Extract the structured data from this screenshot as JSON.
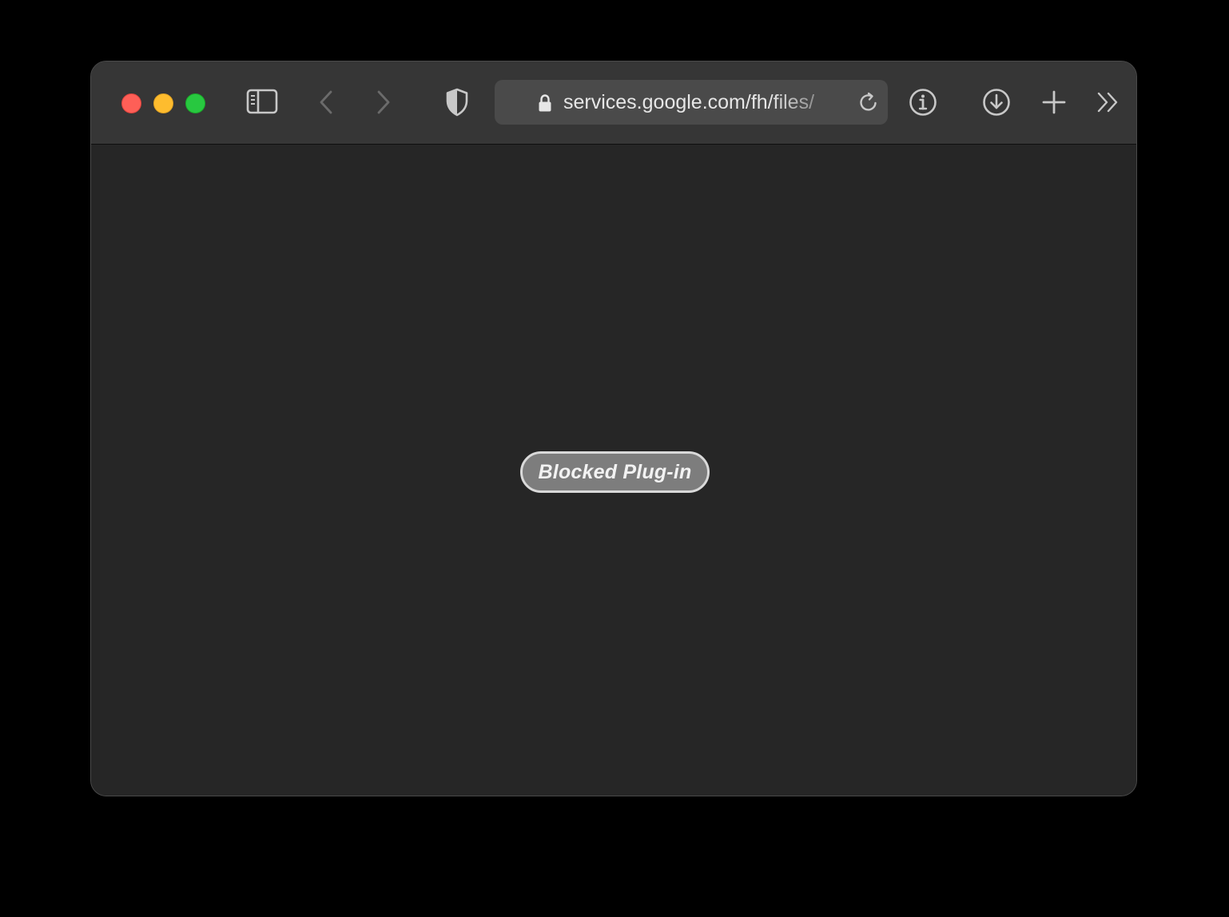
{
  "browser": {
    "address_bar": {
      "url": "services.google.com/fh/files/"
    },
    "icons": {
      "sidebar": "sidebar-icon",
      "back": "chevron-left-icon",
      "forward": "chevron-right-icon",
      "privacy": "shield-icon",
      "lock": "lock-icon",
      "reload": "reload-icon",
      "info": "info-icon",
      "downloads": "download-icon",
      "new_tab": "plus-icon",
      "overflow": "double-chevron-right-icon"
    },
    "colors": {
      "close": "#fe5f57",
      "minimize": "#febc2e",
      "zoom": "#28c840"
    }
  },
  "content": {
    "plugin_label": "Blocked Plug-in"
  }
}
